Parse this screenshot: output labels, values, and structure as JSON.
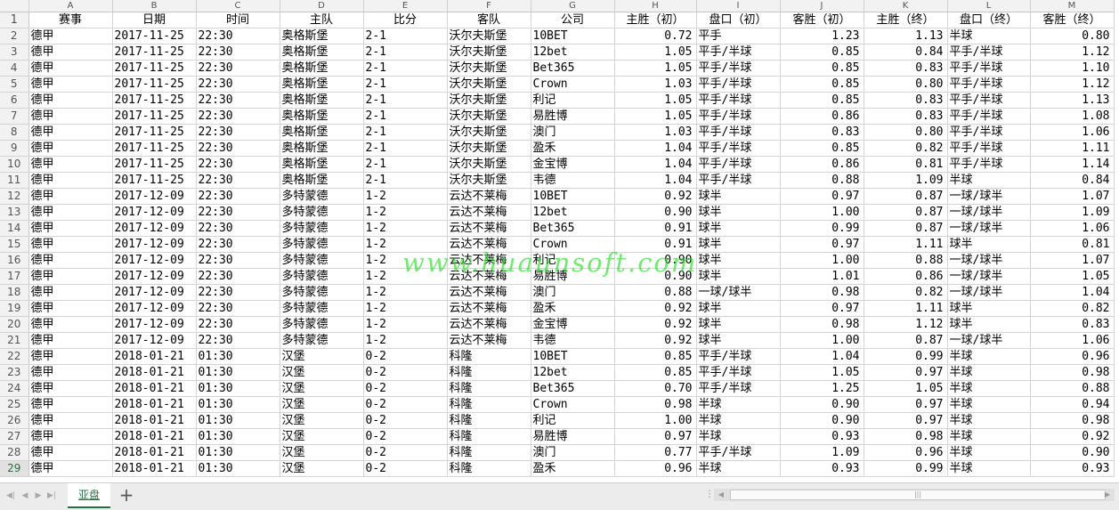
{
  "columns": [
    "A",
    "B",
    "C",
    "D",
    "E",
    "F",
    "G",
    "H",
    "I",
    "J",
    "K",
    "L",
    "M"
  ],
  "headers": [
    "赛事",
    "日期",
    "时间",
    "主队",
    "比分",
    "客队",
    "公司",
    "主胜（初）",
    "盘口（初）",
    "客胜（初）",
    "主胜（终）",
    "盘口（终）",
    "客胜（终）"
  ],
  "rows": [
    {
      "n": "2",
      "c": [
        "德甲",
        "2017-11-25",
        "22:30",
        "奥格斯堡",
        "2-1",
        "沃尔夫斯堡",
        "10BET",
        "0.72",
        "平手",
        "1.23",
        "1.13",
        "半球",
        "0.80"
      ]
    },
    {
      "n": "3",
      "c": [
        "德甲",
        "2017-11-25",
        "22:30",
        "奥格斯堡",
        "2-1",
        "沃尔夫斯堡",
        "12bet",
        "1.05",
        "平手/半球",
        "0.85",
        "0.84",
        "平手/半球",
        "1.12"
      ]
    },
    {
      "n": "4",
      "c": [
        "德甲",
        "2017-11-25",
        "22:30",
        "奥格斯堡",
        "2-1",
        "沃尔夫斯堡",
        "Bet365",
        "1.05",
        "平手/半球",
        "0.85",
        "0.83",
        "平手/半球",
        "1.10"
      ]
    },
    {
      "n": "5",
      "c": [
        "德甲",
        "2017-11-25",
        "22:30",
        "奥格斯堡",
        "2-1",
        "沃尔夫斯堡",
        "Crown",
        "1.03",
        "平手/半球",
        "0.85",
        "0.80",
        "平手/半球",
        "1.12"
      ]
    },
    {
      "n": "6",
      "c": [
        "德甲",
        "2017-11-25",
        "22:30",
        "奥格斯堡",
        "2-1",
        "沃尔夫斯堡",
        "利记",
        "1.05",
        "平手/半球",
        "0.85",
        "0.83",
        "平手/半球",
        "1.13"
      ]
    },
    {
      "n": "7",
      "c": [
        "德甲",
        "2017-11-25",
        "22:30",
        "奥格斯堡",
        "2-1",
        "沃尔夫斯堡",
        "易胜博",
        "1.05",
        "平手/半球",
        "0.86",
        "0.83",
        "平手/半球",
        "1.08"
      ]
    },
    {
      "n": "8",
      "c": [
        "德甲",
        "2017-11-25",
        "22:30",
        "奥格斯堡",
        "2-1",
        "沃尔夫斯堡",
        "澳门",
        "1.03",
        "平手/半球",
        "0.83",
        "0.80",
        "平手/半球",
        "1.06"
      ]
    },
    {
      "n": "9",
      "c": [
        "德甲",
        "2017-11-25",
        "22:30",
        "奥格斯堡",
        "2-1",
        "沃尔夫斯堡",
        "盈禾",
        "1.04",
        "平手/半球",
        "0.85",
        "0.82",
        "平手/半球",
        "1.11"
      ]
    },
    {
      "n": "10",
      "c": [
        "德甲",
        "2017-11-25",
        "22:30",
        "奥格斯堡",
        "2-1",
        "沃尔夫斯堡",
        "金宝博",
        "1.04",
        "平手/半球",
        "0.86",
        "0.81",
        "平手/半球",
        "1.14"
      ]
    },
    {
      "n": "11",
      "c": [
        "德甲",
        "2017-11-25",
        "22:30",
        "奥格斯堡",
        "2-1",
        "沃尔夫斯堡",
        "韦德",
        "1.04",
        "平手/半球",
        "0.88",
        "1.09",
        "半球",
        "0.84"
      ]
    },
    {
      "n": "12",
      "c": [
        "德甲",
        "2017-12-09",
        "22:30",
        "多特蒙德",
        "1-2",
        "云达不莱梅",
        "10BET",
        "0.92",
        "球半",
        "0.97",
        "0.87",
        "一球/球半",
        "1.07"
      ]
    },
    {
      "n": "13",
      "c": [
        "德甲",
        "2017-12-09",
        "22:30",
        "多特蒙德",
        "1-2",
        "云达不莱梅",
        "12bet",
        "0.90",
        "球半",
        "1.00",
        "0.87",
        "一球/球半",
        "1.09"
      ]
    },
    {
      "n": "14",
      "c": [
        "德甲",
        "2017-12-09",
        "22:30",
        "多特蒙德",
        "1-2",
        "云达不莱梅",
        "Bet365",
        "0.91",
        "球半",
        "0.99",
        "0.87",
        "一球/球半",
        "1.06"
      ]
    },
    {
      "n": "15",
      "c": [
        "德甲",
        "2017-12-09",
        "22:30",
        "多特蒙德",
        "1-2",
        "云达不莱梅",
        "Crown",
        "0.91",
        "球半",
        "0.97",
        "1.11",
        "球半",
        "0.81"
      ]
    },
    {
      "n": "16",
      "c": [
        "德甲",
        "2017-12-09",
        "22:30",
        "多特蒙德",
        "1-2",
        "云达不莱梅",
        "利记",
        "0.90",
        "球半",
        "1.00",
        "0.88",
        "一球/球半",
        "1.07"
      ]
    },
    {
      "n": "17",
      "c": [
        "德甲",
        "2017-12-09",
        "22:30",
        "多特蒙德",
        "1-2",
        "云达不莱梅",
        "易胜博",
        "0.90",
        "球半",
        "1.01",
        "0.86",
        "一球/球半",
        "1.05"
      ]
    },
    {
      "n": "18",
      "c": [
        "德甲",
        "2017-12-09",
        "22:30",
        "多特蒙德",
        "1-2",
        "云达不莱梅",
        "澳门",
        "0.88",
        "一球/球半",
        "0.98",
        "0.82",
        "一球/球半",
        "1.04"
      ]
    },
    {
      "n": "19",
      "c": [
        "德甲",
        "2017-12-09",
        "22:30",
        "多特蒙德",
        "1-2",
        "云达不莱梅",
        "盈禾",
        "0.92",
        "球半",
        "0.97",
        "1.11",
        "球半",
        "0.82"
      ]
    },
    {
      "n": "20",
      "c": [
        "德甲",
        "2017-12-09",
        "22:30",
        "多特蒙德",
        "1-2",
        "云达不莱梅",
        "金宝博",
        "0.92",
        "球半",
        "0.98",
        "1.12",
        "球半",
        "0.83"
      ]
    },
    {
      "n": "21",
      "c": [
        "德甲",
        "2017-12-09",
        "22:30",
        "多特蒙德",
        "1-2",
        "云达不莱梅",
        "韦德",
        "0.92",
        "球半",
        "1.00",
        "0.87",
        "一球/球半",
        "1.06"
      ]
    },
    {
      "n": "22",
      "c": [
        "德甲",
        "2018-01-21",
        "01:30",
        "汉堡",
        "0-2",
        "科隆",
        "10BET",
        "0.85",
        "平手/半球",
        "1.04",
        "0.99",
        "半球",
        "0.96"
      ]
    },
    {
      "n": "23",
      "c": [
        "德甲",
        "2018-01-21",
        "01:30",
        "汉堡",
        "0-2",
        "科隆",
        "12bet",
        "0.85",
        "平手/半球",
        "1.05",
        "0.97",
        "半球",
        "0.98"
      ]
    },
    {
      "n": "24",
      "c": [
        "德甲",
        "2018-01-21",
        "01:30",
        "汉堡",
        "0-2",
        "科隆",
        "Bet365",
        "0.70",
        "平手/半球",
        "1.25",
        "1.05",
        "半球",
        "0.88"
      ]
    },
    {
      "n": "25",
      "c": [
        "德甲",
        "2018-01-21",
        "01:30",
        "汉堡",
        "0-2",
        "科隆",
        "Crown",
        "0.98",
        "半球",
        "0.90",
        "0.97",
        "半球",
        "0.94"
      ]
    },
    {
      "n": "26",
      "c": [
        "德甲",
        "2018-01-21",
        "01:30",
        "汉堡",
        "0-2",
        "科隆",
        "利记",
        "1.00",
        "半球",
        "0.90",
        "0.97",
        "半球",
        "0.98"
      ]
    },
    {
      "n": "27",
      "c": [
        "德甲",
        "2018-01-21",
        "01:30",
        "汉堡",
        "0-2",
        "科隆",
        "易胜博",
        "0.97",
        "半球",
        "0.93",
        "0.98",
        "半球",
        "0.92"
      ]
    },
    {
      "n": "28",
      "c": [
        "德甲",
        "2018-01-21",
        "01:30",
        "汉堡",
        "0-2",
        "科隆",
        "澳门",
        "0.77",
        "平手/半球",
        "1.09",
        "0.96",
        "半球",
        "0.90"
      ]
    },
    {
      "n": "29",
      "c": [
        "德甲",
        "2018-01-21",
        "01:30",
        "汉堡",
        "0-2",
        "科隆",
        "盈禾",
        "0.96",
        "半球",
        "0.93",
        "0.99",
        "半球",
        "0.93"
      ]
    }
  ],
  "watermark": "www.huaunsoft.com",
  "tabs": [
    "亚盘"
  ],
  "add_sheet_label": "+",
  "colors": {
    "accent": "#217346",
    "watermark": "#28dc28",
    "grid": "#d4d4d4",
    "header_bg": "#f2f2f2"
  }
}
